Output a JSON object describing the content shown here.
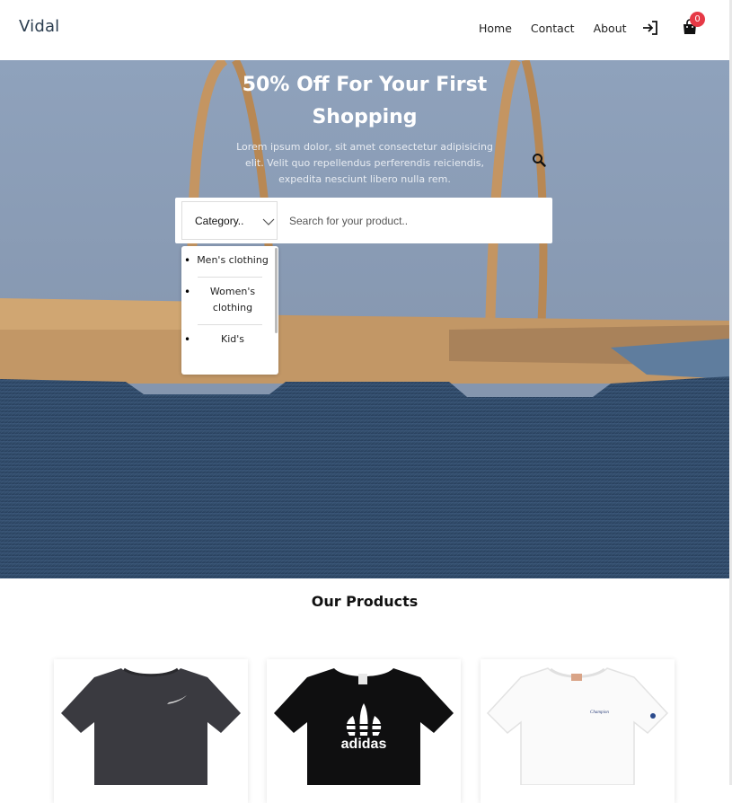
{
  "brand": "Vidal",
  "nav": {
    "links": [
      "Home",
      "Contact",
      "About"
    ]
  },
  "cart": {
    "count": "0"
  },
  "icons": {
    "login": "login-icon",
    "cart": "shopping-bag-icon",
    "search": "search-icon",
    "chevron": "chevron-down-icon"
  },
  "hero": {
    "title_line1": "50% Off For Your First",
    "title_line2": "Shopping",
    "subtitle": "Lorem ipsum dolor, sit amet consectetur adipisicing elit. Velit quo repellendus perferendis reiciendis, expedita nesciunt libero nulla rem."
  },
  "search": {
    "category_label": "Category..",
    "placeholder": "Search for your product..",
    "value": ""
  },
  "category_dropdown": {
    "options": [
      "Men's clothing",
      "Women's clothing",
      "Kid's"
    ]
  },
  "products_section": {
    "title": "Our Products"
  },
  "products": [
    {
      "name": "dark-tshirt",
      "logo": ""
    },
    {
      "name": "black-tshirt",
      "logo": "adidas"
    },
    {
      "name": "white-tshirt",
      "logo": "Champion"
    }
  ],
  "colors": {
    "badge": "#e63946",
    "brand": "#2c3e50",
    "hero_sky": "#8fa3bd",
    "denim": "#2f4a66",
    "paper": "#c59a68"
  }
}
